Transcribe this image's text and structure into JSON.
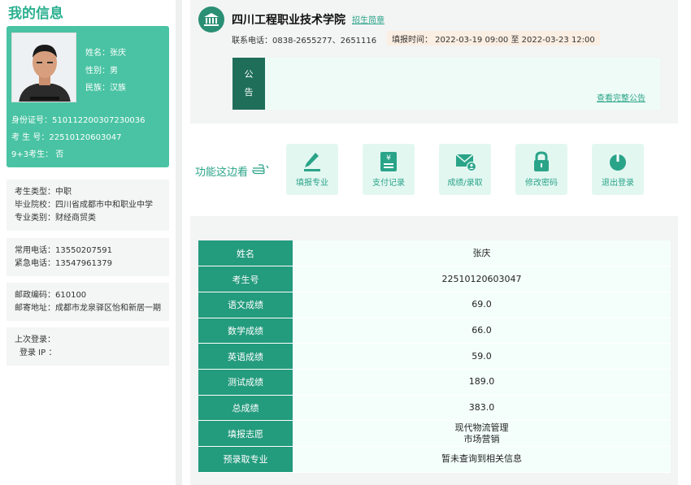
{
  "left": {
    "title": "我的信息",
    "profile": {
      "name_label": "姓名：",
      "name": "张庆",
      "gender_label": "性别：",
      "gender": "男",
      "ethnicity_label": "民族：",
      "ethnicity": "汉族",
      "id_card": "身份证号：510112200307230036",
      "exam_no": "考 生 号：22510120603047",
      "nine_plus_three": "9+3考生：  否"
    },
    "box1": {
      "type": "考生类型：中职",
      "school": "毕业院校：四川省成都市中和职业中学",
      "major_category": "专业类别：财经商贸类"
    },
    "box2": {
      "phone": "常用电话：13550207591",
      "emergency": "紧急电话：13547961379"
    },
    "box3": {
      "postcode": "邮政编码：610100",
      "address": "邮寄地址：成都市龙泉驿区怡和新居一期"
    },
    "box4": {
      "last_login": "上次登录：",
      "login_ip": "登录 IP ："
    }
  },
  "school": {
    "name": "四川工程职业技术学院",
    "brochure_link": "招生简章",
    "phone": "联系电话：0838-2655277、2651116",
    "fill_time": "填报时间：  2022-03-19 09:00 至 2022-03-23 12:00",
    "notice_label_1": "公",
    "notice_label_2": "告",
    "notice_link": "查看完整公告"
  },
  "functions": {
    "title": "功能这边看",
    "buttons": [
      {
        "label": "填报专业",
        "icon": "pencil-icon"
      },
      {
        "label": "支付记录",
        "icon": "receipt-icon"
      },
      {
        "label": "成绩/录取",
        "icon": "mail-user-icon"
      },
      {
        "label": "修改密码",
        "icon": "lock-icon"
      },
      {
        "label": "退出登录",
        "icon": "power-icon"
      }
    ]
  },
  "scores": [
    {
      "key": "姓名",
      "value": "张庆"
    },
    {
      "key": "考生号",
      "value": "22510120603047"
    },
    {
      "key": "语文成绩",
      "value": "69.0"
    },
    {
      "key": "数学成绩",
      "value": "66.0"
    },
    {
      "key": "英语成绩",
      "value": "59.0"
    },
    {
      "key": "测试成绩",
      "value": "189.0"
    },
    {
      "key": "总成绩",
      "value": "383.0"
    },
    {
      "key": "填报志愿",
      "value": "现代物流管理",
      "value2": "市场营销"
    },
    {
      "key": "预录取专业",
      "value": "暂未查询到相关信息"
    }
  ],
  "colors": {
    "accent": "#2aa489",
    "card": "#49c3a3",
    "table_key": "#239b7d",
    "notice_label": "#1e6e5a"
  }
}
